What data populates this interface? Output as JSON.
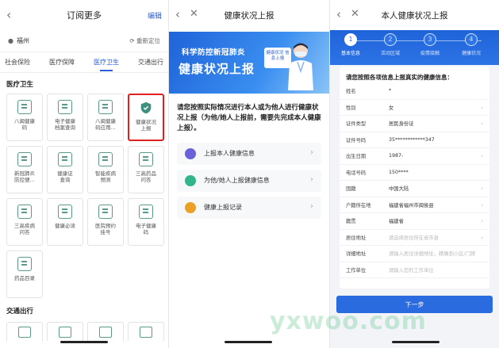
{
  "panel1": {
    "title": "订阅更多",
    "edit": "编辑",
    "location": "福州",
    "relocate": "重新定位",
    "tabs": [
      "社会保险",
      "医疗保障",
      "医疗卫生",
      "交通出行"
    ],
    "active_tab": "医疗卫生",
    "section_medical": "医疗卫生",
    "services": [
      [
        "八闽健康",
        "码"
      ],
      [
        "电子健康",
        "档案查询"
      ],
      [
        "八闽健康",
        "码应用..."
      ],
      [
        "健康状况",
        "上报"
      ],
      [
        "新冠肺炎",
        "防控便..."
      ],
      [
        "健康证",
        "查询"
      ],
      [
        "智能疾病",
        "预测"
      ],
      [
        "三高药品",
        "问答"
      ],
      [
        "三高疾病",
        "问答"
      ],
      [
        "健康必读",
        ""
      ],
      [
        "医院预约",
        "挂号"
      ],
      [
        "电子健康",
        "码"
      ],
      [
        "药品目录",
        ""
      ]
    ],
    "section_transport": "交通出行",
    "accent": "#2a5fd8",
    "highlight": "#e02020"
  },
  "panel2": {
    "title": "健康状况上报",
    "banner_line1": "科学防控新冠肺炎",
    "banner_line2": "健康状况上报",
    "banner_tag": "健康状况 信息上报",
    "intro": "请您按照实际情况进行本人或为他人进行健康状况上报（为他/她人上报前，需要先完成本人健康上报）。",
    "options": [
      {
        "label": "上报本人健康信息",
        "color": "#6b62d9"
      },
      {
        "label": "为他/她人上报健康信息",
        "color": "#33b48b"
      },
      {
        "label": "健康上报记录",
        "color": "#e9a227"
      }
    ]
  },
  "panel3": {
    "title": "本人健康状况上报",
    "steps": [
      "基本信息",
      "活动区域",
      "疫情接触",
      "健康状况"
    ],
    "hint": "请您按照各项信息上报真实的健康信息：",
    "fields": [
      {
        "label": "姓名",
        "value": "*",
        "ph": false,
        "chev": false
      },
      {
        "label": "性别",
        "value": "女",
        "ph": false,
        "chev": true
      },
      {
        "label": "证件类型",
        "value": "居民身份证",
        "ph": false,
        "chev": true
      },
      {
        "label": "证件号码",
        "value": "35************347",
        "ph": false,
        "chev": false
      },
      {
        "label": "出生日期",
        "value": "1987-",
        "ph": false,
        "chev": true
      },
      {
        "label": "电话号码",
        "value": "150****",
        "ph": false,
        "chev": false
      },
      {
        "label": "国籍",
        "value": "中国大陆",
        "ph": false,
        "chev": true
      },
      {
        "label": "户籍所在地",
        "value": "福建省福州市闽侯县",
        "ph": false,
        "chev": true
      },
      {
        "label": "籍贯",
        "value": "福建省",
        "ph": false,
        "chev": true
      },
      {
        "label": "居住地址",
        "value": "请选择居住所在省市县",
        "ph": true,
        "chev": true
      },
      {
        "label": "详细地址",
        "value": "请输入居住详细地址，精确到小区/门牌",
        "ph": true,
        "chev": false
      },
      {
        "label": "工作单位",
        "value": "请输入您的工作单位",
        "ph": true,
        "chev": false
      }
    ],
    "next": "下一步"
  },
  "watermark": "yxwoo.com"
}
